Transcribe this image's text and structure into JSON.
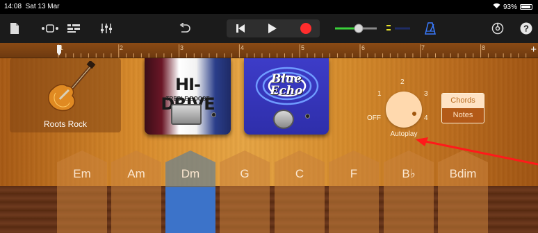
{
  "status_bar": {
    "time": "14:08",
    "date": "Sat 13 Mar",
    "battery": "93%"
  },
  "toolbar": {
    "icons": [
      "document-icon",
      "view-toggle-icon",
      "tracks-icon",
      "mixer-icon",
      "undo-icon",
      "rewind-icon",
      "play-icon",
      "record-icon",
      "master-volume-slider",
      "metronome-icon",
      "settings-icon",
      "help-icon"
    ],
    "record_color": "#ff2d2d",
    "volume_color": "#3ad13a",
    "metronome_color": "#3a7bff"
  },
  "ruler": {
    "bars": [
      "1",
      "2",
      "3",
      "4",
      "5",
      "6",
      "7",
      "8"
    ],
    "add_label": "+"
  },
  "instrument": {
    "name": "Roots Rock"
  },
  "pedals": {
    "hdrive": {
      "title": "HI-DRIVE",
      "subtitle": "TREBLE BOOST"
    },
    "blue_echo": {
      "line1": "Blue",
      "line2": "Echo"
    }
  },
  "autoplay": {
    "label": "Autoplay",
    "positions": {
      "off": "OFF",
      "p1": "1",
      "p2": "2",
      "p3": "3",
      "p4": "4"
    },
    "selected": "4"
  },
  "mode": {
    "chords": "Chords",
    "notes": "Notes",
    "selected": "Notes"
  },
  "chords": [
    "Em",
    "Am",
    "Dm",
    "G",
    "C",
    "F",
    "B♭",
    "Bdim"
  ],
  "active_chord": "Dm",
  "annotation_arrow_color": "#ff1a1a"
}
